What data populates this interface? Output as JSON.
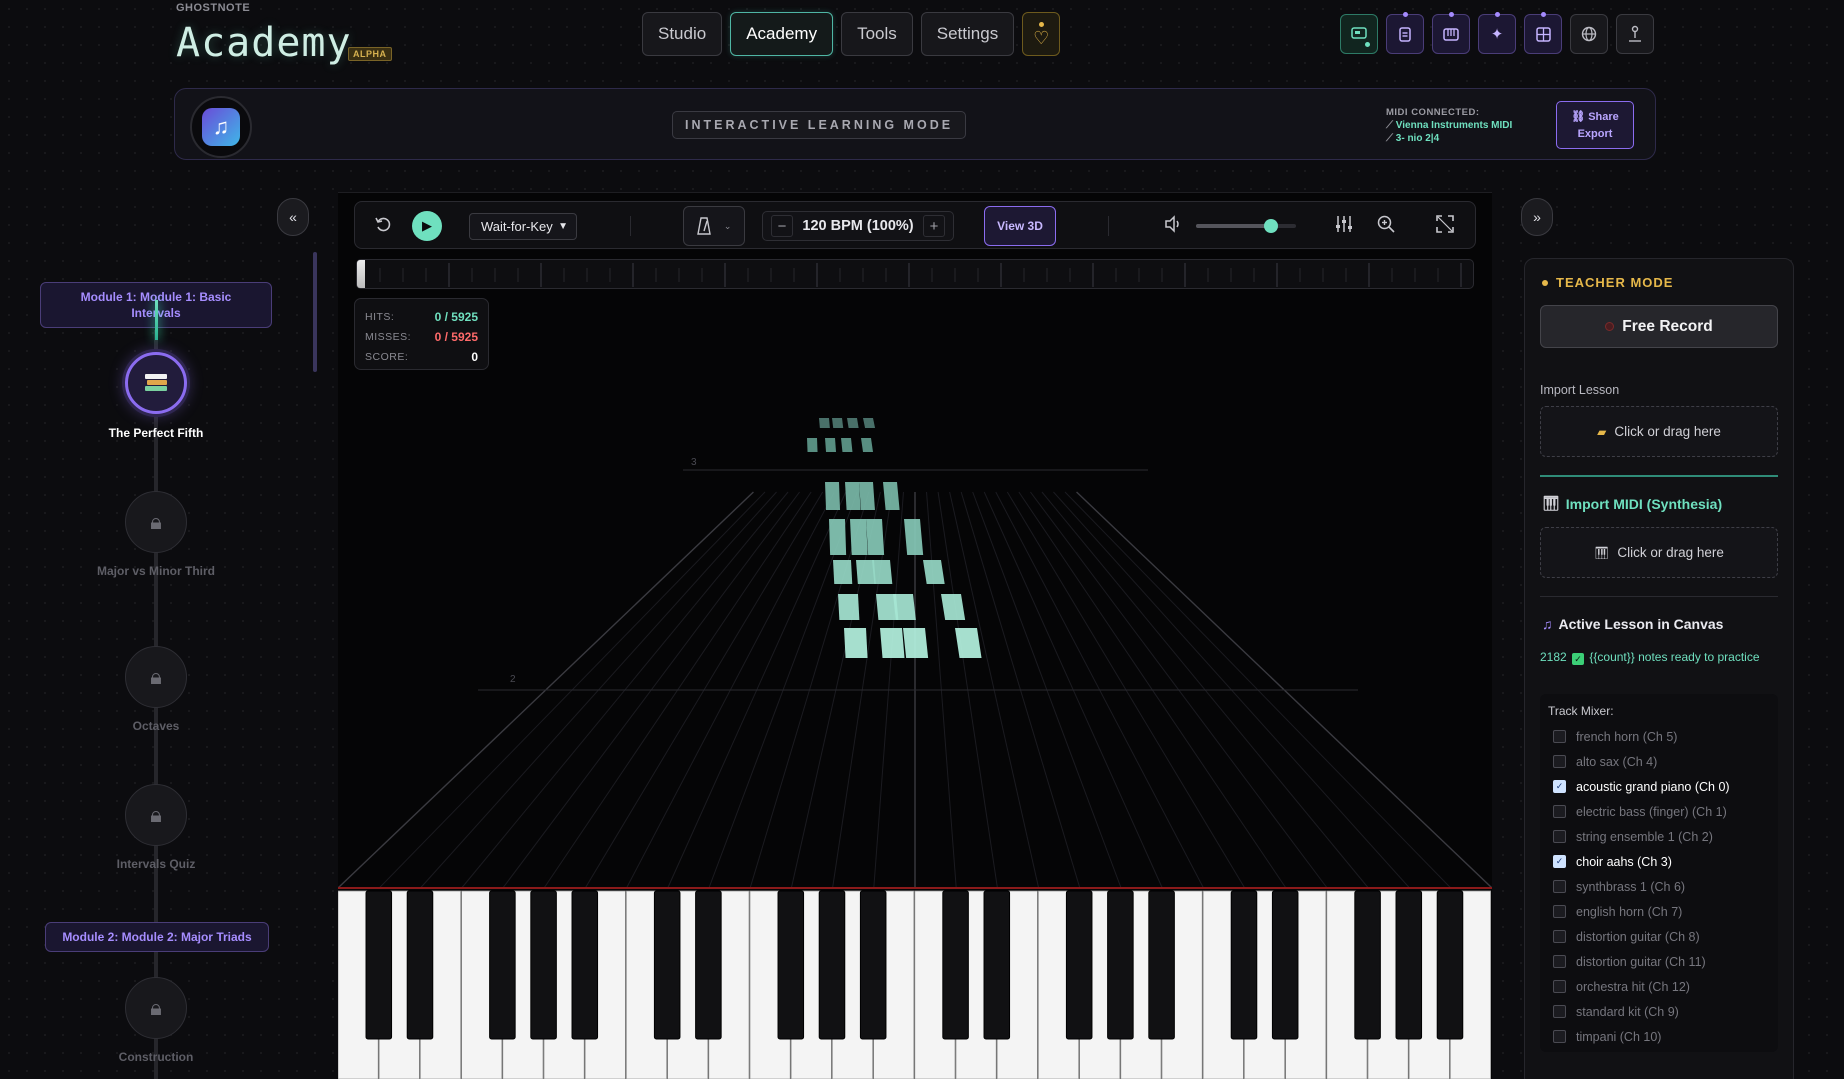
{
  "brand": {
    "small": "GHOSTNOTE",
    "title": "Academy",
    "badge": "ALPHA"
  },
  "nav": [
    {
      "label": "Studio",
      "active": false
    },
    {
      "label": "Academy",
      "active": true
    },
    {
      "label": "Tools",
      "active": false
    },
    {
      "label": "Settings",
      "active": false
    }
  ],
  "toolbar_icons": [
    "screen-icon",
    "clipboard-icon",
    "keyboard-icon",
    "sparkle-icon",
    "grid-icon",
    "globe-icon",
    "person-icon"
  ],
  "banner": {
    "mode": "INTERACTIVE LEARNING MODE",
    "midi_label": "MIDI CONNECTED:",
    "midi_devices": [
      "Vienna Instruments MIDI",
      "3- nio 2|4"
    ],
    "share": "Share",
    "export": "Export"
  },
  "modules": {
    "module1": "Module 1: Module 1: Basic Intervals",
    "module2": "Module 2: Module 2: Major Triads",
    "lessons": [
      {
        "title": "The Perfect Fifth",
        "state": "active",
        "icon": "books-icon"
      },
      {
        "title": "Major vs Minor Third",
        "state": "locked",
        "icon": "lock-icon"
      },
      {
        "title": "Octaves",
        "state": "locked",
        "icon": "lock-icon"
      },
      {
        "title": "Intervals Quiz",
        "state": "locked",
        "icon": "lock-icon"
      },
      {
        "title": "Construction",
        "state": "locked",
        "icon": "lock-icon"
      }
    ]
  },
  "transport": {
    "mode_select": "Wait-for-Key",
    "bpm": "120 BPM (100%)",
    "view3d": "View 3D",
    "volume_percent": 76
  },
  "stats": {
    "hits_label": "HITS:",
    "hits": "0 / 5925",
    "misses_label": "MISSES:",
    "misses": "0 / 5925",
    "score_label": "SCORE:",
    "score": "0"
  },
  "highway": {
    "marker_3": "3",
    "marker_2": "2"
  },
  "teacher": {
    "title": "TEACHER MODE",
    "free_record": "Free Record",
    "import_lesson": "Import Lesson",
    "click_drag": "Click or drag here",
    "import_midi": "Import MIDI (Synthesia)",
    "click_drag_midi": "Click or drag here",
    "active_lesson": "Active Lesson in Canvas",
    "note_count": "2182",
    "notes_ready": "{{count}} notes ready to practice",
    "mixer_title": "Track Mixer:",
    "tracks": [
      {
        "label": "french horn (Ch 5)",
        "on": false
      },
      {
        "label": "alto sax (Ch 4)",
        "on": false
      },
      {
        "label": "acoustic grand piano (Ch 0)",
        "on": true
      },
      {
        "label": "electric bass (finger) (Ch 1)",
        "on": false
      },
      {
        "label": "string ensemble 1 (Ch 2)",
        "on": false
      },
      {
        "label": "choir aahs (Ch 3)",
        "on": true
      },
      {
        "label": "synthbrass 1 (Ch 6)",
        "on": false
      },
      {
        "label": "english horn (Ch 7)",
        "on": false
      },
      {
        "label": "distortion guitar (Ch 8)",
        "on": false
      },
      {
        "label": "distortion guitar (Ch 11)",
        "on": false
      },
      {
        "label": "orchestra hit (Ch 12)",
        "on": false
      },
      {
        "label": "standard kit (Ch 9)",
        "on": false
      },
      {
        "label": "timpani (Ch 10)",
        "on": false
      }
    ]
  },
  "colors": {
    "accent_teal": "#6fe0bf",
    "accent_purple": "#8b6cf0",
    "accent_gold": "#e6b84a",
    "miss_red": "#ff6a6a"
  }
}
